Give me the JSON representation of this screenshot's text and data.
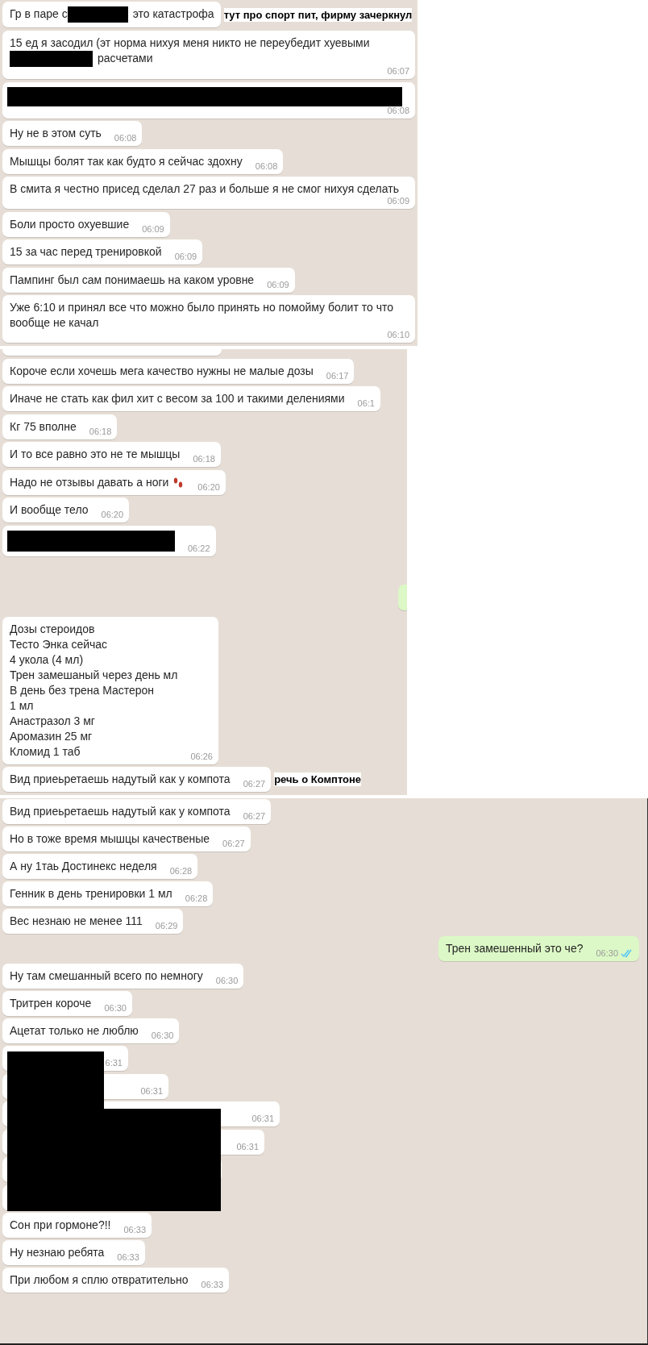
{
  "sections": [
    {
      "messages": [
        {
          "kind": "incoming",
          "parts": [
            {
              "kind": "text",
              "text": "Гр в паре с"
            },
            {
              "kind": "redacted_word"
            },
            {
              "kind": "text",
              "text": "это катастрофа"
            }
          ],
          "note": "тут про спорт пит, фирму зачеркнул"
        },
        {
          "kind": "incoming",
          "parts": [
            {
              "kind": "text",
              "text": "15 ед я засодил (эт норма нихуя меня никто не переубедит хуевыми"
            },
            {
              "kind": "redacted_phrase"
            },
            {
              "kind": "text",
              "text": "расчетами"
            }
          ],
          "time": "06:07"
        },
        {
          "kind": "incoming",
          "parts": [
            {
              "kind": "redacted_line"
            }
          ],
          "time": "06:08"
        },
        {
          "kind": "incoming",
          "parts": [
            {
              "kind": "text",
              "text": "Ну не в этом суть"
            }
          ],
          "time": "06:08"
        },
        {
          "kind": "incoming",
          "parts": [
            {
              "kind": "text",
              "text": "Мышцы болят так как будто я сейчас здохну"
            }
          ],
          "time": "06:08"
        },
        {
          "kind": "incoming",
          "parts": [
            {
              "kind": "text",
              "text": "В смита я честно присед сделал 27 раз и больше я не смог нихуя сделать"
            }
          ],
          "time": "06:09"
        },
        {
          "kind": "incoming",
          "parts": [
            {
              "kind": "text",
              "text": "Боли просто охуевшие"
            }
          ],
          "time": "06:09"
        },
        {
          "kind": "incoming",
          "parts": [
            {
              "kind": "text",
              "text": "15 за час перед тренировкой"
            }
          ],
          "time": "06:09"
        },
        {
          "kind": "incoming",
          "parts": [
            {
              "kind": "text",
              "text": "Пампинг был сам понимаешь на каком уровне"
            }
          ],
          "time": "06:09"
        },
        {
          "kind": "incoming",
          "parts": [
            {
              "kind": "text",
              "text": "Уже 6:10 и принял все что можно было принять но помойму болит то что вообще не качал"
            }
          ],
          "time": "06:10"
        }
      ]
    },
    {
      "messages": [
        {
          "kind": "incoming_fragment"
        },
        {
          "kind": "incoming",
          "parts": [
            {
              "kind": "text",
              "text": "Короче если хочешь мега качество нужны не малые дозы"
            }
          ],
          "time": "06:17"
        },
        {
          "kind": "incoming",
          "parts": [
            {
              "kind": "text",
              "text": "Иначе не стать как фил хит с весом за 100 и такими делениями"
            }
          ],
          "time": "06:1"
        },
        {
          "kind": "incoming",
          "parts": [
            {
              "kind": "text",
              "text": "Кг 75 вполне"
            }
          ],
          "time": "06:18"
        },
        {
          "kind": "incoming",
          "parts": [
            {
              "kind": "text",
              "text": "И то все равно это не те мышцы"
            }
          ],
          "time": "06:18"
        },
        {
          "kind": "incoming",
          "parts": [
            {
              "kind": "text",
              "text": "Надо не отзывы давать а ноги"
            },
            {
              "kind": "footprints"
            }
          ],
          "time": "06:20"
        },
        {
          "kind": "incoming",
          "parts": [
            {
              "kind": "text",
              "text": "И вообще тело"
            }
          ],
          "time": "06:20"
        },
        {
          "kind": "incoming",
          "parts": [
            {
              "kind": "redacted_block"
            }
          ],
          "time": "06:22"
        },
        {
          "kind": "outgoing_fragment"
        },
        {
          "kind": "incoming",
          "parts": [
            {
              "kind": "text",
              "text": "Дозы стероидов\nТесто Энка сейчас\n4 укола (4 мл)\nТрен замешаный через день мл\nВ день без трена Мастерон\n1 мл\nАнастразол 3 мг\nАромазин 25 мг\nКломид 1 таб"
            }
          ],
          "time": "06:26"
        },
        {
          "kind": "incoming",
          "parts": [
            {
              "kind": "text",
              "text": "Вид приеьретаешь надутый как у компота"
            }
          ],
          "time": "06:27",
          "note": "речь о Комптоне"
        }
      ]
    },
    {
      "messages": [
        {
          "kind": "incoming",
          "parts": [
            {
              "kind": "text",
              "text": "Вид приеьретаешь надутый как у компота"
            }
          ],
          "time": "06:27"
        },
        {
          "kind": "incoming",
          "parts": [
            {
              "kind": "text",
              "text": "Но в тоже время мышцы качественые"
            }
          ],
          "time": "06:27"
        },
        {
          "kind": "incoming",
          "parts": [
            {
              "kind": "text",
              "text": "А ну 1таь Достинекс неделя"
            }
          ],
          "time": "06:28"
        },
        {
          "kind": "incoming",
          "parts": [
            {
              "kind": "text",
              "text": "Генник в день тренировки 1 мл"
            }
          ],
          "time": "06:28"
        },
        {
          "kind": "incoming",
          "parts": [
            {
              "kind": "text",
              "text": "Вес незнаю не менее 111"
            }
          ],
          "time": "06:29"
        },
        {
          "kind": "outgoing",
          "parts": [
            {
              "kind": "text",
              "text": "Трен замешенный это че?"
            }
          ],
          "time": "06:30",
          "read": true
        },
        {
          "kind": "incoming",
          "parts": [
            {
              "kind": "text",
              "text": "Ну там смешанный всего по немногу"
            }
          ],
          "time": "06:30"
        },
        {
          "kind": "incoming",
          "parts": [
            {
              "kind": "text",
              "text": "Тритрен короче"
            }
          ],
          "time": "06:30"
        },
        {
          "kind": "incoming",
          "parts": [
            {
              "kind": "text",
              "text": "Ацетат только не люблю"
            }
          ],
          "time": "06:30"
        },
        {
          "kind": "covered_group",
          "messages": [
            {
              "kind": "incoming",
              "time": "6:31"
            },
            {
              "kind": "incoming",
              "time": "06:31"
            },
            {
              "kind": "incoming",
              "time": "06:31"
            },
            {
              "kind": "incoming",
              "time": "06:31"
            },
            {
              "kind": "incoming"
            },
            {
              "kind": "incoming"
            }
          ]
        },
        {
          "kind": "incoming",
          "parts": [
            {
              "kind": "text",
              "text": "Сон при гормоне?!!"
            }
          ],
          "time": "06:33"
        },
        {
          "kind": "incoming",
          "parts": [
            {
              "kind": "text",
              "text": "Ну незнаю ребята"
            }
          ],
          "time": "06:33"
        },
        {
          "kind": "incoming",
          "parts": [
            {
              "kind": "text",
              "text": "При любом я сплю отвратительно"
            }
          ],
          "time": "06:33"
        }
      ]
    }
  ]
}
